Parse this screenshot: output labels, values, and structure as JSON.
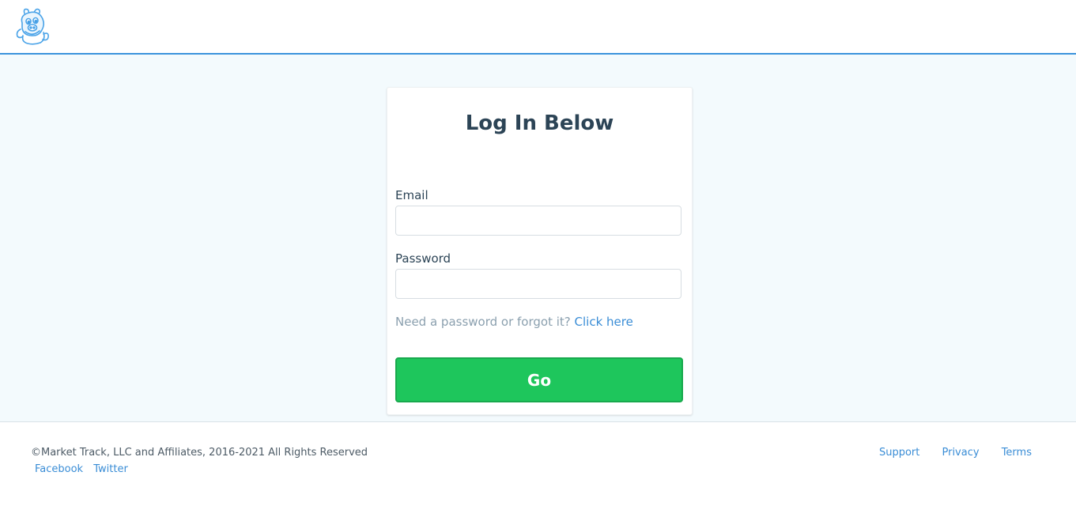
{
  "header": {
    "logo_icon": "cartoon-pig-mascot-icon"
  },
  "login": {
    "title": "Log In Below",
    "email_label": "Email",
    "email_value": "",
    "password_label": "Password",
    "password_value": "",
    "help_text": "Need a password or forgot it?",
    "help_link": "Click here",
    "submit_label": "Go"
  },
  "footer": {
    "copyright": "©Market Track, LLC and Affiliates, 2016-2021 All Rights Reserved",
    "social": [
      "Facebook",
      "Twitter"
    ],
    "links": [
      "Support",
      "Privacy",
      "Terms"
    ]
  },
  "colors": {
    "accent": "#3a93dc",
    "button": "#1ec65c",
    "background": "#f3fafd",
    "link": "#3a8dd6"
  }
}
